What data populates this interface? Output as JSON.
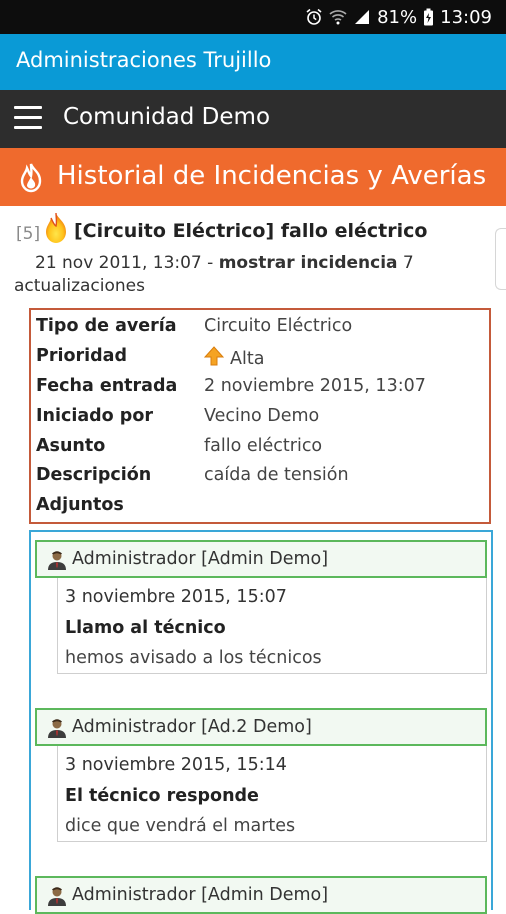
{
  "status_bar": {
    "battery": "81%",
    "time": "13:09"
  },
  "app": {
    "title": "Administraciones Trujillo"
  },
  "toolbar": {
    "title": "Comunidad Demo",
    "menu_icon": "hamburger-menu-icon"
  },
  "section": {
    "title": "Historial de Incidencias y Averías",
    "icon": "fire-icon"
  },
  "incident": {
    "number": "[5]",
    "title": "[Circuito Eléctrico] fallo eléctrico",
    "date": "21 nov 2011, 13:07",
    "separator": " - ",
    "link": "mostrar incidencia",
    "updates_count": " 7 actualizaciones"
  },
  "details": [
    {
      "label": "Tipo de avería",
      "value": "Circuito Eléctrico"
    },
    {
      "label": "Prioridad",
      "value": "Alta"
    },
    {
      "label": "Fecha entrada",
      "value": "2 noviembre 2015, 13:07"
    },
    {
      "label": "Iniciado por",
      "value": "Vecino Demo"
    },
    {
      "label": "Asunto",
      "value": "fallo eléctrico"
    },
    {
      "label": "Descripción",
      "value": "caída de tensión"
    },
    {
      "label": "Adjuntos",
      "value": ""
    }
  ],
  "updates": [
    {
      "author": "Administrador [Admin Demo]",
      "date": "3 noviembre 2015, 15:07",
      "subject": "Llamo al técnico",
      "text": "hemos avisado a los técnicos"
    },
    {
      "author": "Administrador [Ad.2 Demo]",
      "date": "3 noviembre 2015, 15:14",
      "subject": "El técnico responde",
      "text": "dice que vendrá el martes"
    },
    {
      "author": "Administrador [Admin Demo]",
      "date": "",
      "subject": "",
      "text": ""
    }
  ],
  "colors": {
    "appbar": "#0a9ad6",
    "toolbar": "#2d2d2d",
    "section": "#ef6a2d",
    "details_border": "#c45a3a",
    "thread_border": "#3aa7d8",
    "update_border": "#5cb85c"
  }
}
